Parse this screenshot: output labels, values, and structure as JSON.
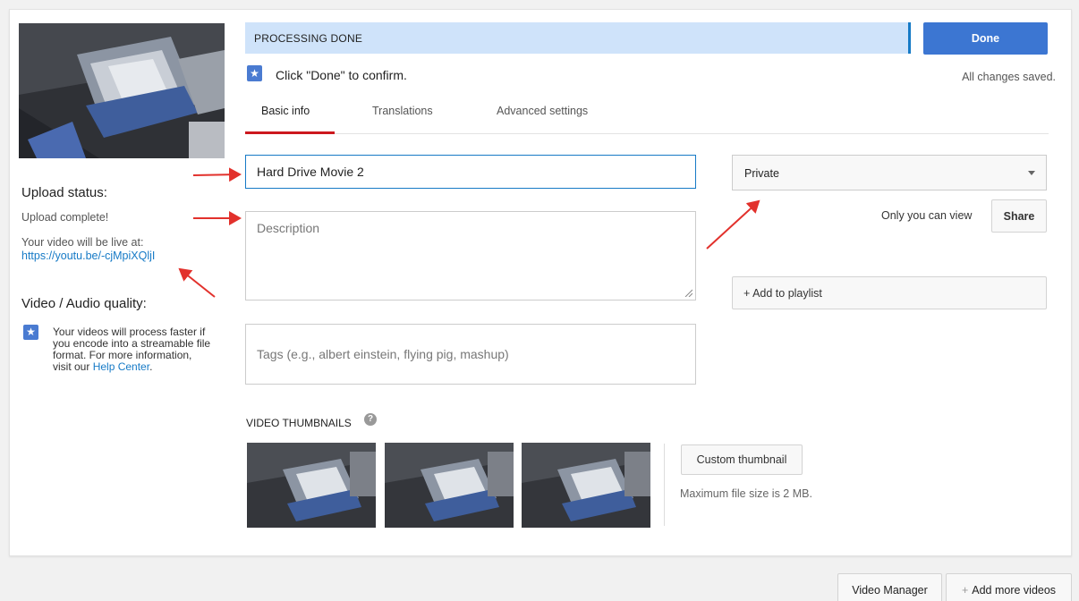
{
  "status": {
    "processing": "PROCESSING DONE",
    "confirm": "Click \"Done\" to confirm.",
    "saved": "All changes saved."
  },
  "actions": {
    "done": "Done",
    "share": "Share",
    "add_to_playlist": "+ Add to playlist",
    "custom_thumbnail": "Custom thumbnail",
    "video_manager": "Video Manager",
    "add_more_videos": "Add more videos"
  },
  "tabs": [
    {
      "label": "Basic info",
      "active": true
    },
    {
      "label": "Translations",
      "active": false
    },
    {
      "label": "Advanced settings",
      "active": false
    }
  ],
  "form": {
    "title_value": "Hard Drive Movie 2",
    "description_placeholder": "Description",
    "tags_placeholder": "Tags (e.g., albert einstein, flying pig, mashup)"
  },
  "privacy": {
    "selected": "Private",
    "note": "Only you can view"
  },
  "sidebar": {
    "upload_status_title": "Upload status:",
    "upload_complete": "Upload complete!",
    "live_at": "Your video will be live at:",
    "link": "https://youtu.be/-cjMpiXQljI",
    "quality_title": "Video / Audio quality:",
    "quality_text": "Your videos will process faster if you encode into a streamable file format. For more information, visit our",
    "help_center": "Help Center",
    "help_center_suffix": "."
  },
  "thumbnails": {
    "title": "VIDEO THUMBNAILS",
    "max_size": "Maximum file size is 2 MB."
  },
  "colors": {
    "accent_blue": "#3c76d2",
    "link_blue": "#167ac6",
    "processing_bg": "#cfe3fa",
    "tab_red": "#cc181e",
    "annotation_red": "#e2312c"
  }
}
